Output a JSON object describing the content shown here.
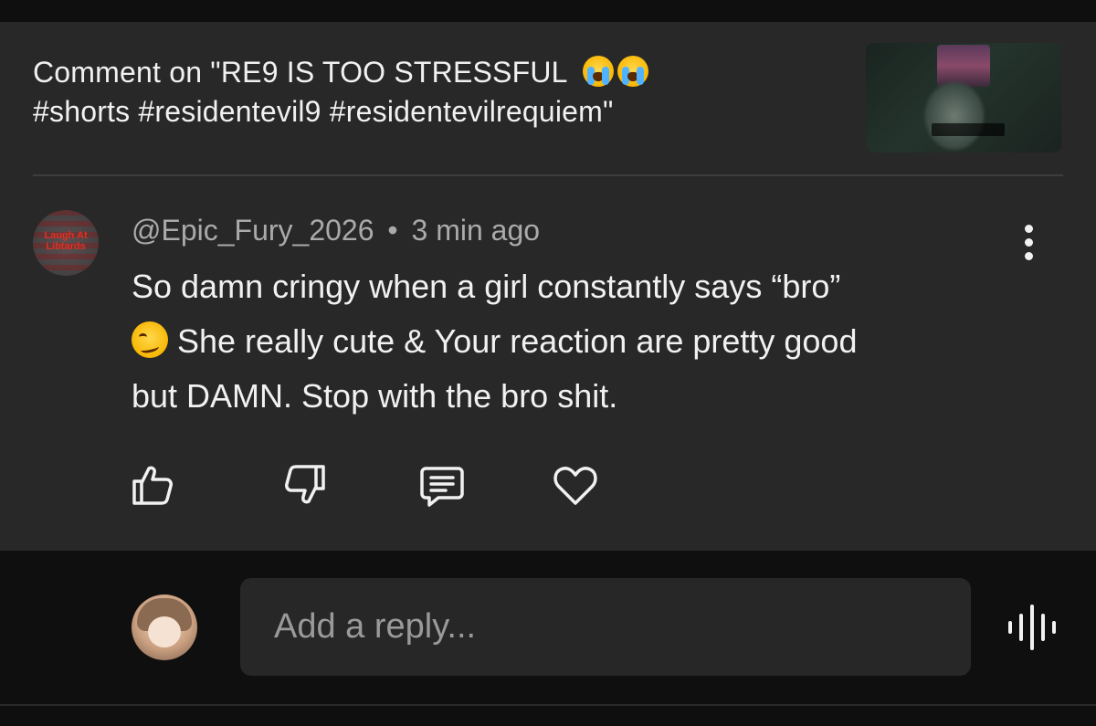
{
  "header": {
    "title_line1": "Comment on \"RE9 IS TOO STRESSFUL",
    "title_emoji": [
      "loudly-crying-face",
      "loudly-crying-face"
    ],
    "title_line2": "#shorts #residentevil9 #residentevilrequiem\"",
    "thumbnail_icon": "video-thumbnail"
  },
  "comment": {
    "author": "@Epic_Fury_2026",
    "separator": "•",
    "time": "3 min ago",
    "avatar_text": "Laugh At Libtards",
    "body_line1": "So damn cringy when a girl constantly says “bro”",
    "body_emoji": "woozy-face",
    "body_line2": "She really cute & Your reaction are pretty good",
    "body_line3": "but DAMN. Stop with the bro shit.",
    "actions": [
      "like-icon",
      "dislike-icon",
      "reply-icon",
      "heart-icon"
    ],
    "menu_icon": "more-vertical-icon"
  },
  "reply": {
    "placeholder": "Add a reply...",
    "voice_icon": "voice-search-icon"
  },
  "colors": {
    "panel": "#282828",
    "background": "#0f0f0f",
    "text": "#f1f1f1",
    "secondary_text": "#aaaaaa",
    "input_bg": "#272727",
    "divider": "#3d3d3d"
  }
}
